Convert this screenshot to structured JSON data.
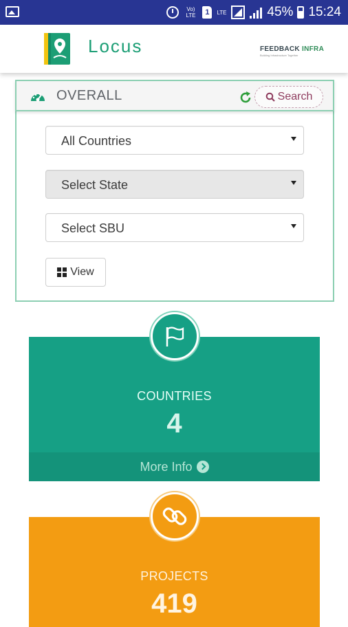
{
  "status_bar": {
    "battery": "45%",
    "time": "15:24",
    "volte": "Vo) LTE",
    "sim": "1",
    "lte": "LTE",
    "icons": [
      "gallery-notification-icon",
      "alarm-icon",
      "volte-icon",
      "sim-icon",
      "lte-icon",
      "signal-icon",
      "battery-icon"
    ]
  },
  "header": {
    "app_name": "Locus",
    "partner_name_a": "FEEDBACK",
    "partner_name_b": " INFRA",
    "partner_tagline": "Building Infrastructure Together"
  },
  "overall": {
    "title": "OVERALL",
    "search_label": "Search",
    "country_select": "All Countries",
    "state_select": "Select State",
    "sbu_select": "Select SBU",
    "view_label": "View"
  },
  "cards": {
    "countries": {
      "label": "COUNTRIES",
      "value": "4",
      "more": "More Info",
      "color": "#16a085"
    },
    "projects": {
      "label": "PROJECTS",
      "value": "419",
      "color": "#f39c12"
    }
  },
  "colors": {
    "status_bar": "#283593",
    "brand_green": "#1c9e75",
    "panel_border": "#8ccfb2",
    "search_accent": "#8e3b5d"
  }
}
